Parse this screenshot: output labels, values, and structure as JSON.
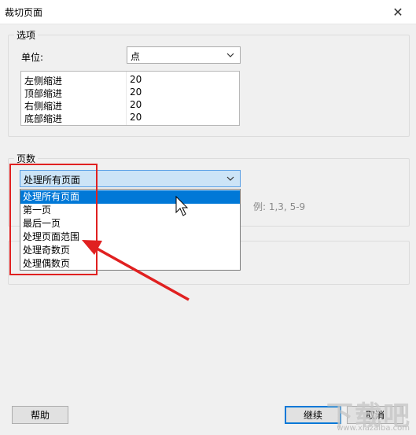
{
  "window": {
    "title": "裁切页面",
    "close_glyph": "✕"
  },
  "options": {
    "group_label": "选项",
    "unit_label": "单位:",
    "unit_value": "点",
    "margins": [
      {
        "label": "左侧缩进",
        "value": "20"
      },
      {
        "label": "顶部缩进",
        "value": "20"
      },
      {
        "label": "右侧缩进",
        "value": "20"
      },
      {
        "label": "底部缩进",
        "value": "20"
      }
    ]
  },
  "pages": {
    "group_label": "页数",
    "selected": "处理所有页面",
    "options": [
      "处理所有页面",
      "第一页",
      "最后一页",
      "处理页面范围",
      "处理奇数页",
      "处理偶数页"
    ],
    "range_hint": "例: 1,3, 5-9"
  },
  "buttons": {
    "help": "帮助",
    "continue": "继续",
    "cancel": "取消"
  },
  "watermark": {
    "text": "下载吧",
    "sub": "www.xiazaiba.com"
  },
  "colors": {
    "highlight": "#0078d7",
    "annotation_red": "#e02020"
  }
}
